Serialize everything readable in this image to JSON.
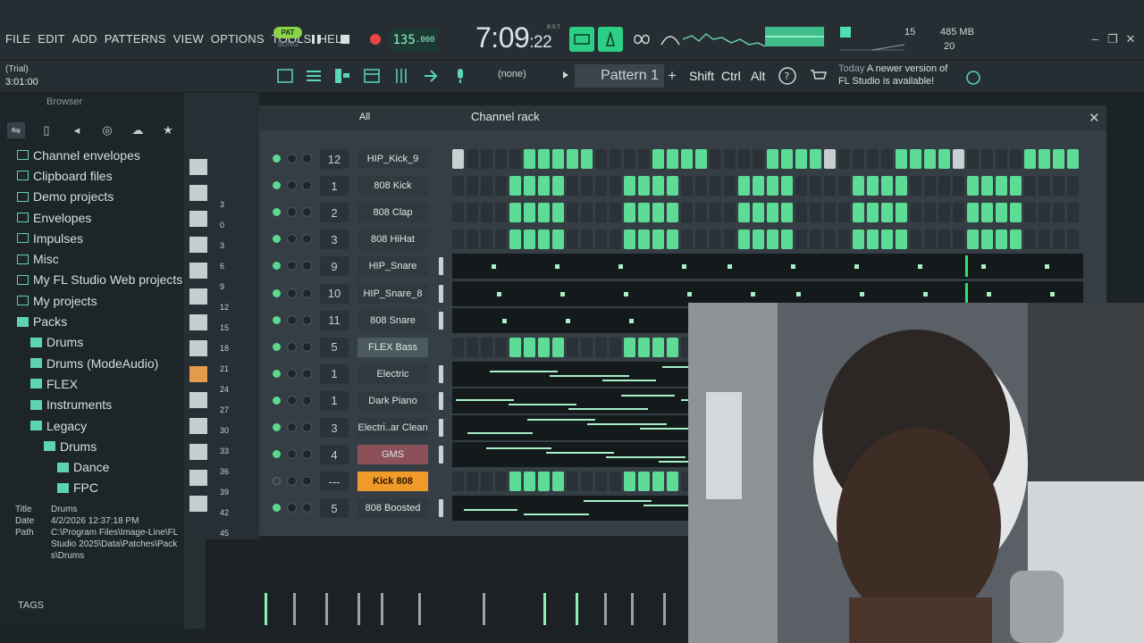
{
  "menu": [
    "FILE",
    "EDIT",
    "ADD",
    "PATTERNS",
    "VIEW",
    "OPTIONS",
    "TOOLS",
    "HELP"
  ],
  "transport": {
    "pat_label": "PAT",
    "song_label": "SONG",
    "tempo_main": "135",
    "tempo_frac": ".000",
    "time_main": "7:09",
    "time_frac": ":22",
    "time_unit": "B:S:T"
  },
  "cpu": {
    "polyphony": "15",
    "memory": "485 MB",
    "cores": "20"
  },
  "status": {
    "trial": "(Trial)",
    "time": "3:01:00"
  },
  "toolbar2": {
    "none_label": "(none)",
    "pattern": "Pattern 1",
    "shift": "Shift",
    "ctrl": "Ctrl",
    "alt": "Alt",
    "news_today": "Today",
    "news_line1": "A newer version of",
    "news_line2": "FL Studio is available!"
  },
  "browser": {
    "title": "Browser",
    "items": [
      {
        "label": "Channel envelopes",
        "indent": 0,
        "open": false
      },
      {
        "label": "Clipboard files",
        "indent": 0,
        "open": false
      },
      {
        "label": "Demo projects",
        "indent": 0,
        "open": false
      },
      {
        "label": "Envelopes",
        "indent": 0,
        "open": false
      },
      {
        "label": "Impulses",
        "indent": 0,
        "open": false
      },
      {
        "label": "Misc",
        "indent": 0,
        "open": false
      },
      {
        "label": "My FL Studio Web projects",
        "indent": 0,
        "open": false
      },
      {
        "label": "My projects",
        "indent": 0,
        "open": false
      },
      {
        "label": "Packs",
        "indent": 0,
        "open": true
      },
      {
        "label": "Drums",
        "indent": 1,
        "open": true
      },
      {
        "label": "Drums (ModeAudio)",
        "indent": 1,
        "open": true
      },
      {
        "label": "FLEX",
        "indent": 1,
        "open": true
      },
      {
        "label": "Instruments",
        "indent": 1,
        "open": true
      },
      {
        "label": "Legacy",
        "indent": 1,
        "open": true
      },
      {
        "label": "Drums",
        "indent": 2,
        "open": true
      },
      {
        "label": "Dance",
        "indent": 3,
        "open": true
      },
      {
        "label": "FPC",
        "indent": 3,
        "open": true
      }
    ],
    "info": {
      "title_key": "Title",
      "title_val": "Drums",
      "date_key": "Date",
      "date_val": "4/2/2026 12:37:18 PM",
      "path_key": "Path",
      "path_val": "C:\\Program Files\\Image-Line\\FL Studio 2025\\Data\\Patches\\Packs\\Drums"
    },
    "tags_label": "TAGS"
  },
  "mixer_strip_numbers": [
    "3",
    "0",
    "3",
    "6",
    "9",
    "12",
    "15",
    "18",
    "21",
    "24",
    "27",
    "30",
    "33",
    "36",
    "39",
    "42",
    "45"
  ],
  "rack": {
    "all_label": "All",
    "title": "Channel rack",
    "add_label": "+",
    "channels": [
      {
        "num": "12",
        "name": "HIP_Kick_9",
        "style": "",
        "mode": "steps",
        "pattern": "w0000ooooo0000oooo0000oooow0000oooow0000oooo"
      },
      {
        "num": "1",
        "name": "808 Kick",
        "style": "",
        "mode": "steps",
        "pattern": "0000oooo0000oooo0000oooo0000oooo0000oooo0000oooo"
      },
      {
        "num": "2",
        "name": "808 Clap",
        "style": "",
        "mode": "steps",
        "pattern": "0000oooo0000oooo0000oooo0000oooo0000oooo0000oooo"
      },
      {
        "num": "3",
        "name": "808 HiHat",
        "style": "",
        "mode": "steps",
        "pattern": "0000oooo0000oooo0000oooo0000oooo0000oooo0000oooo"
      },
      {
        "num": "9",
        "name": "HIP_Snare",
        "style": "",
        "mode": "roll"
      },
      {
        "num": "10",
        "name": "HIP_Snare_8",
        "style": "",
        "mode": "roll"
      },
      {
        "num": "11",
        "name": "808 Snare",
        "style": "",
        "mode": "roll"
      },
      {
        "num": "5",
        "name": "FLEX Bass",
        "style": "hl",
        "mode": "steps",
        "pattern": "0000oooo0000oooo0000oooo0000oooo"
      },
      {
        "num": "1",
        "name": "Electric",
        "style": "",
        "mode": "roll"
      },
      {
        "num": "1",
        "name": "Dark Piano",
        "style": "",
        "mode": "roll"
      },
      {
        "num": "3",
        "name": "Electri..ar Clean",
        "style": "",
        "mode": "roll"
      },
      {
        "num": "4",
        "name": "GMS",
        "style": "red",
        "mode": "roll"
      },
      {
        "num": "---",
        "name": "Kick 808",
        "style": "sel",
        "mode": "steps",
        "pattern": "0000oooo0000oooo"
      },
      {
        "num": "5",
        "name": "808 Boosted",
        "style": "",
        "mode": "roll"
      }
    ]
  },
  "colors": {
    "accent": "#5ddc96",
    "selected": "#f09a2a",
    "folder": "#5ed3b4"
  }
}
